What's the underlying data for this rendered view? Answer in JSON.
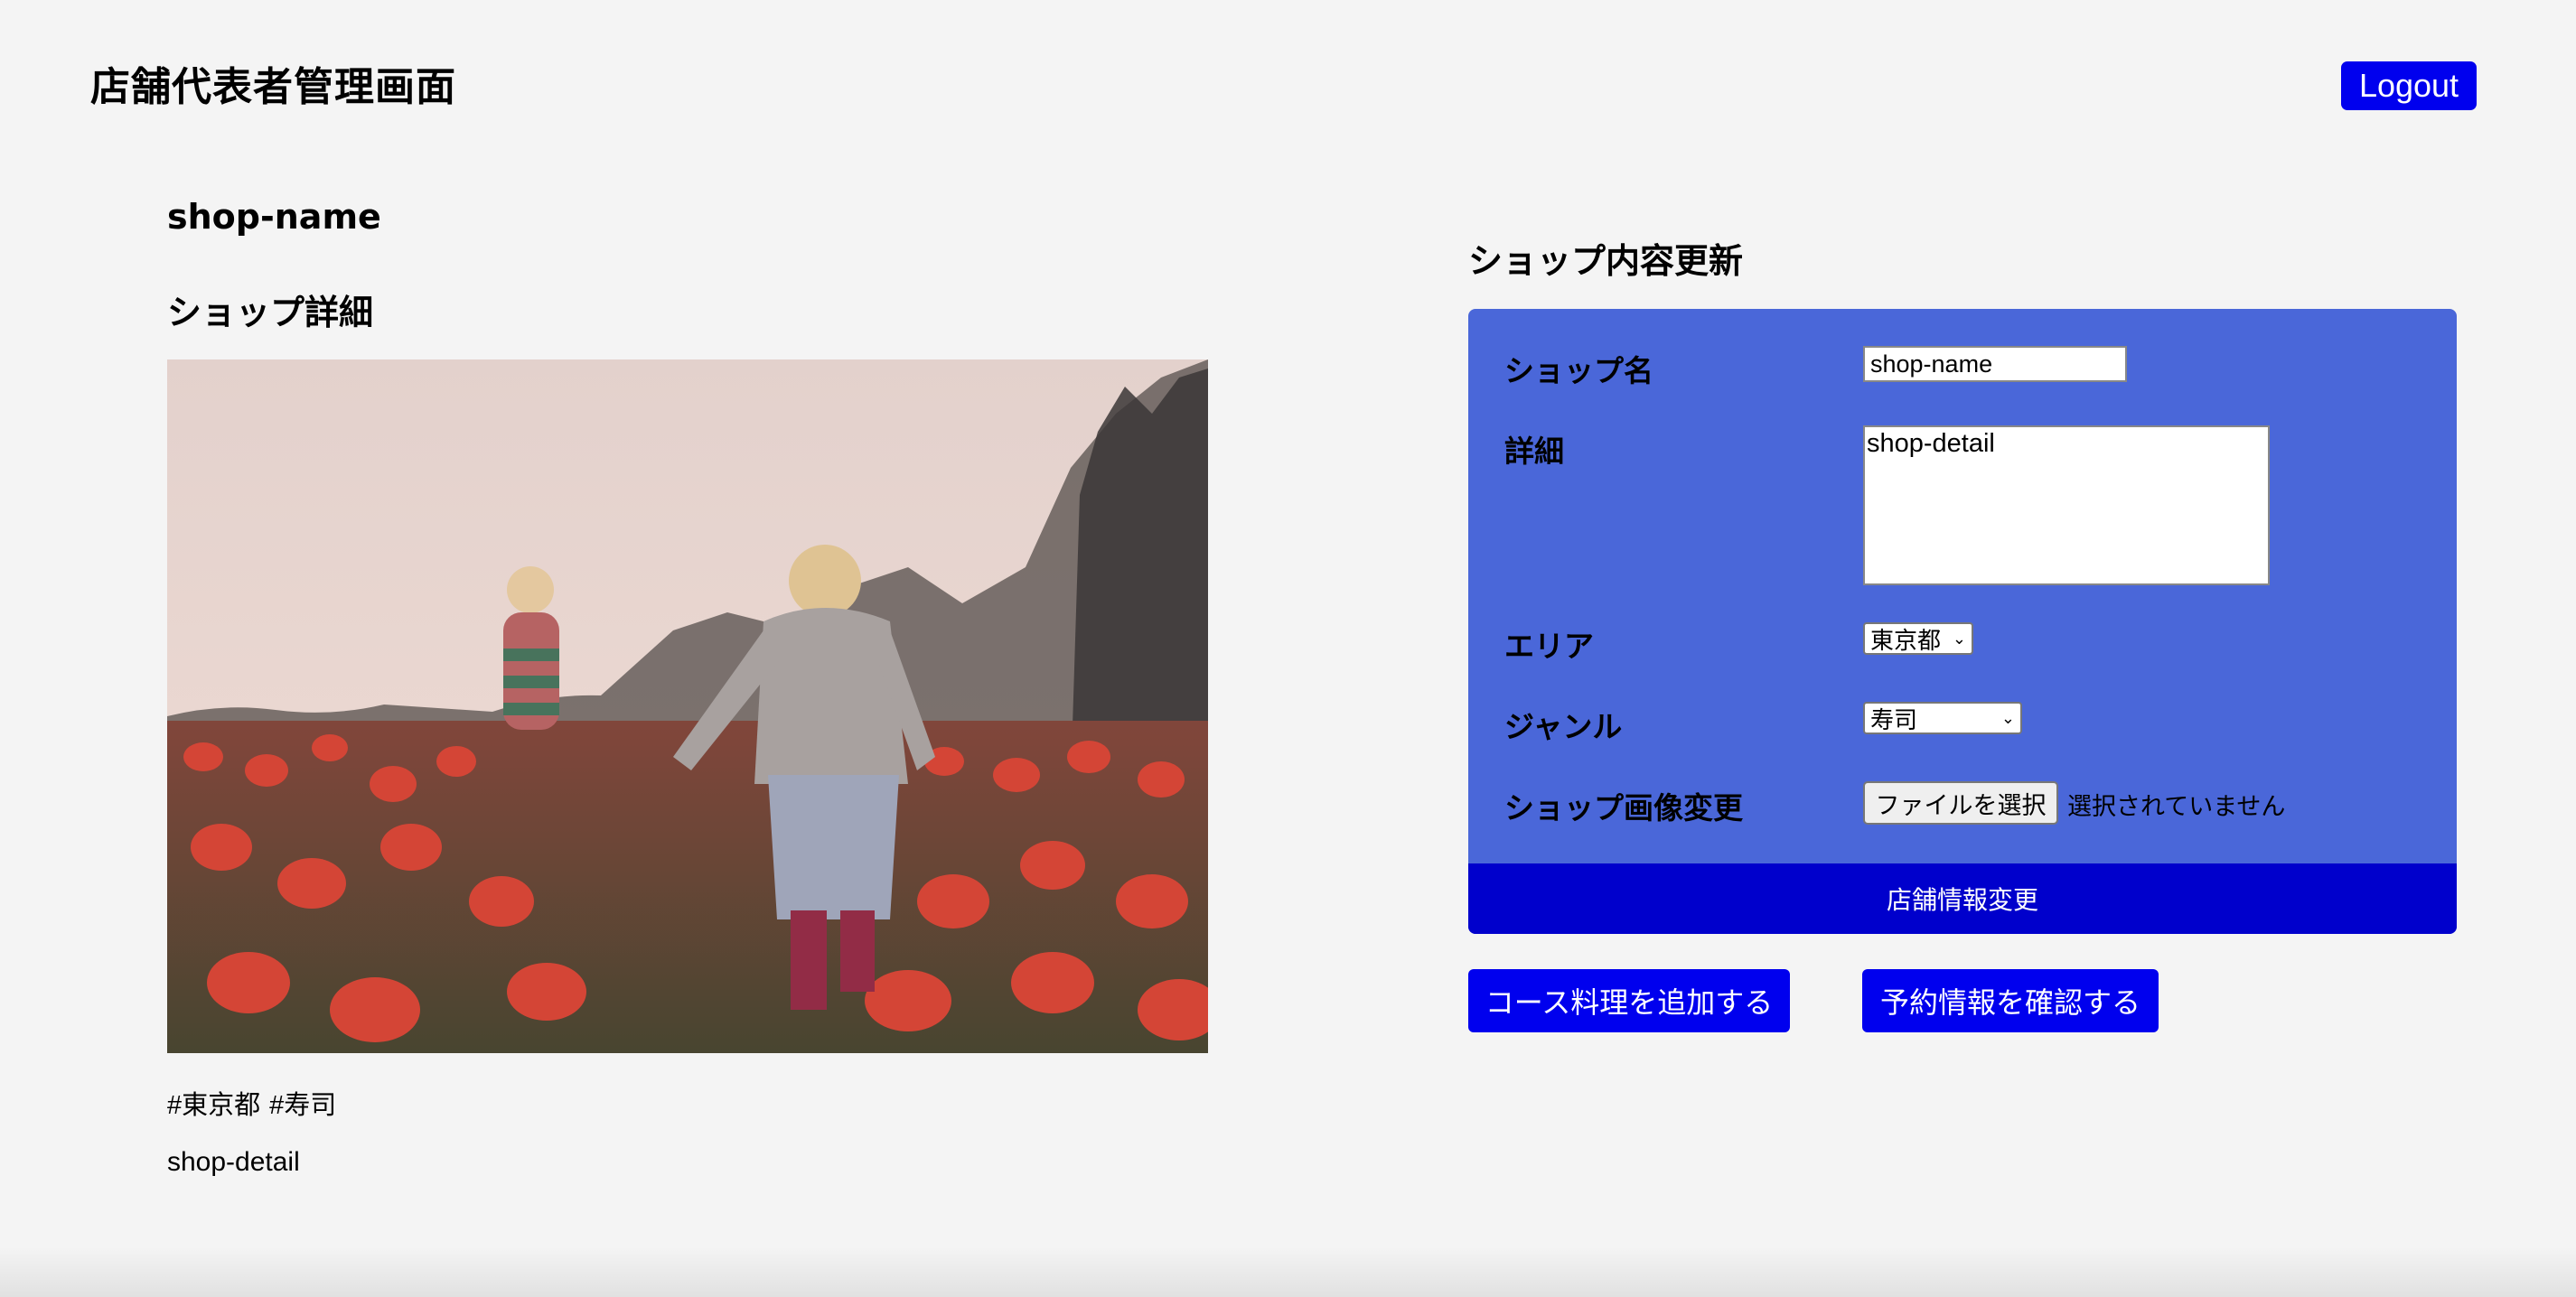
{
  "header": {
    "title": "店舗代表者管理画面",
    "logout_label": "Logout"
  },
  "shop": {
    "name": "shop-name",
    "detail_heading": "ショップ詳細",
    "image_alt": "two children walking through a red tulip field",
    "tags": [
      "#東京都",
      "#寿司"
    ],
    "detail": "shop-detail"
  },
  "update_form": {
    "heading": "ショップ内容更新",
    "fields": {
      "name_label": "ショップ名",
      "name_value": "shop-name",
      "detail_label": "詳細",
      "detail_value": "shop-detail",
      "area_label": "エリア",
      "area_value": "東京都",
      "genre_label": "ジャンル",
      "genre_value": "寿司",
      "image_label": "ショップ画像変更",
      "file_button_label": "ファイルを選択",
      "file_status": "選択されていません"
    },
    "submit_label": "店舗情報変更"
  },
  "actions": {
    "add_course_label": "コース料理を追加する",
    "check_reservations_label": "予約情報を確認する"
  },
  "colors": {
    "background": "#f4f4f4",
    "primary_button": "#0000ee",
    "form_panel": "#4a67d9",
    "submit_bar": "#0000cc"
  }
}
